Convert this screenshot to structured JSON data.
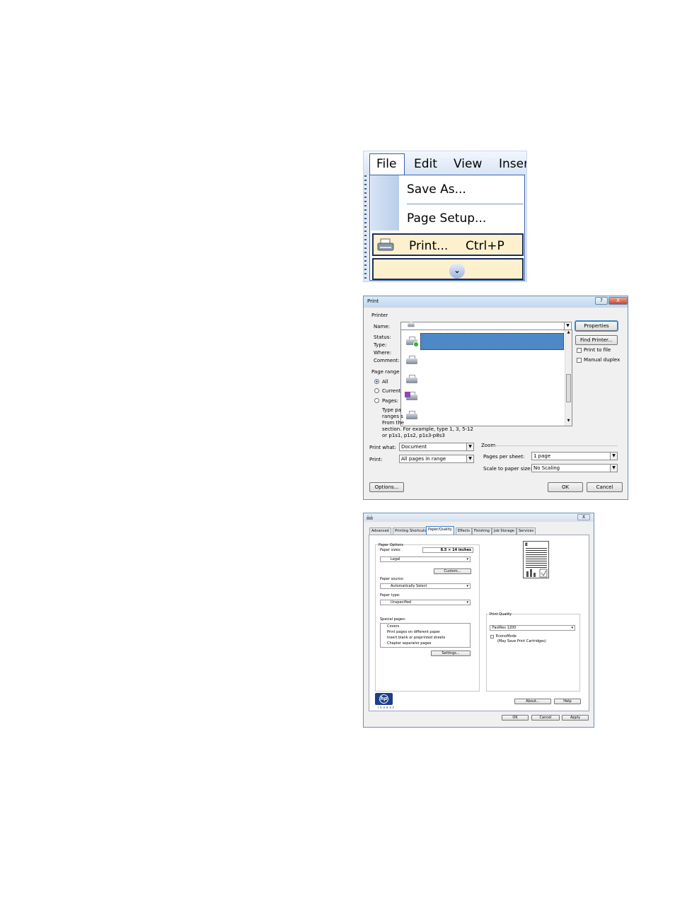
{
  "menu": {
    "bar": [
      "File",
      "Edit",
      "View",
      "Inser"
    ],
    "items": {
      "save_as": "Save As...",
      "page_setup": "Page Setup...",
      "print": "Print...",
      "print_shortcut": "Ctrl+P"
    }
  },
  "print_dialog": {
    "title": "Print",
    "printer_group": "Printer",
    "name_label": "Name:",
    "status_label": "Status:",
    "type_label": "Type:",
    "where_label": "Where:",
    "comment_label": "Comment:",
    "properties_button": "Properties",
    "find_printer_button": "Find Printer...",
    "print_to_file": "Print to file",
    "manual_duplex": "Manual duplex",
    "page_range_group": "Page range",
    "range_all": "All",
    "range_current": "Current",
    "range_pages": "Pages:",
    "help_text": [
      "Type pa",
      "ranges s",
      "From the",
      "section. For example, type 1, 3, 5-12",
      "or p1s1, p1s2, p1s3-p8s3"
    ],
    "print_what_label": "Print what:",
    "print_what_value": "Document",
    "print_label": "Print:",
    "print_value": "All pages in range",
    "zoom_group": "Zoom",
    "pages_per_sheet_label": "Pages per sheet:",
    "pages_per_sheet_value": "1 page",
    "scale_label": "Scale to paper size:",
    "scale_value": "No Scaling",
    "options_button": "Options...",
    "ok_button": "OK",
    "cancel_button": "Cancel",
    "help_btn": "?",
    "close_btn": "X"
  },
  "props_dialog": {
    "close_btn": "X",
    "tabs": [
      "Advanced",
      "Printing Shortcuts",
      "Paper/Quality",
      "Effects",
      "Finishing",
      "Job Storage",
      "Services"
    ],
    "active_tab": "Paper/Quality",
    "paper_options": "Paper Options",
    "paper_sizes_label": "Paper sizes:",
    "paper_size_dim": "8.5 × 14 inches",
    "paper_size_value": "Legal",
    "custom_button": "Custom...",
    "paper_source_label": "Paper source:",
    "paper_source_value": "Automatically Select",
    "paper_type_label": "Paper type:",
    "paper_type_value": "Unspecified",
    "special_pages_label": "Special pages:",
    "special_pages": [
      "Covers",
      "Print pages on different paper",
      "Insert blank or preprinted sheets",
      "Chapter separator pages"
    ],
    "settings_button": "Settings...",
    "print_quality_label": "Print Quality",
    "print_quality_value": "FastRes 1200",
    "economode_label": "EconoMode",
    "economode_note": "(May Save Print Cartridges)",
    "preview_letter": "E",
    "logo_text": "invent",
    "about_button": "About...",
    "help_button": "Help",
    "ok_button": "OK",
    "cancel_button": "Cancel",
    "apply_button": "Apply"
  }
}
